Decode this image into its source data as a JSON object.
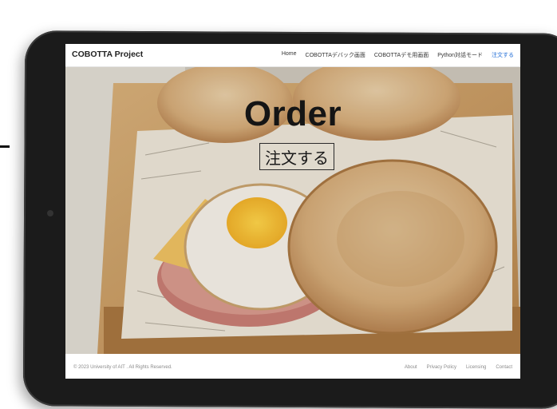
{
  "nav": {
    "brand": "COBOTTA Project",
    "items": [
      {
        "label": "Home"
      },
      {
        "label": "COBOTTAデバック画面"
      },
      {
        "label": "COBOTTAデモ用画面"
      },
      {
        "label": "Python対話モード"
      },
      {
        "label": "注文する"
      }
    ]
  },
  "hero": {
    "title": "Order",
    "button_label": "注文する"
  },
  "footer": {
    "copyright": "© 2023 University of AIT . All Rights Reserved.",
    "links": [
      {
        "label": "About"
      },
      {
        "label": "Privacy Policy"
      },
      {
        "label": "Licensing"
      },
      {
        "label": "Contact"
      }
    ]
  },
  "colors": {
    "accent": "#1e6bd6",
    "bezel": "#1b1b1b"
  }
}
